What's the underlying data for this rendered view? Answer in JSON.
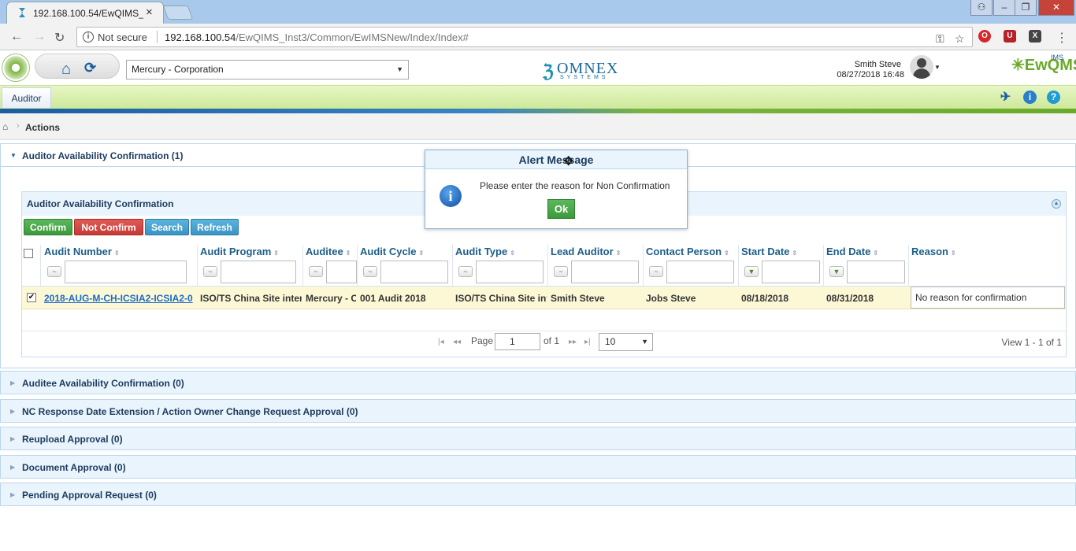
{
  "browser": {
    "tab_title": "192.168.100.54/EwQIMS_",
    "security_label": "Not secure",
    "url_host": "192.168.100.54",
    "url_path": "/EwQIMS_Inst3/Common/EwIMSNew/Index/Index#"
  },
  "header": {
    "org_select_value": "Mercury - Corporation",
    "omnex_name": "OMNEX",
    "omnex_sub": "SYSTEMS",
    "user_name": "Smith Steve",
    "user_datetime": "08/27/2018 16:48",
    "product_logo": "EwQMS",
    "product_logo_sup": "IMS"
  },
  "toolbar": {
    "role_tab": "Auditor"
  },
  "breadcrumb": {
    "label": "Actions"
  },
  "sections": [
    {
      "label": "Auditor Availability Confirmation (1)"
    },
    {
      "label": "Auditee Availability Confirmation (0)"
    },
    {
      "label": "NC Response Date Extension / Action Owner Change Request Approval (0)"
    },
    {
      "label": "Reupload Approval (0)"
    },
    {
      "label": "Document Approval (0)"
    },
    {
      "label": "Pending Approval Request (0)"
    }
  ],
  "grid": {
    "title": "Auditor Availability Confirmation",
    "buttons": {
      "confirm": "Confirm",
      "not_confirm": "Not Confirm",
      "search": "Search",
      "refresh": "Refresh"
    },
    "columns": [
      "Audit Number",
      "Audit Program",
      "Auditee",
      "Audit Cycle",
      "Audit Type",
      "Lead Auditor",
      "Contact Person",
      "Start Date",
      "End Date",
      "Reason"
    ],
    "rows": [
      {
        "audit_number": "2018-AUG-M-CH-ICSIA2-ICSIA2-0",
        "audit_program": "ISO/TS China Site inter",
        "auditee": "Mercury - Co",
        "audit_cycle": "001 Audit 2018",
        "audit_type": "ISO/TS China Site int",
        "lead_auditor": "Smith Steve",
        "contact_person": "Jobs Steve",
        "start_date": "08/18/2018",
        "end_date": "08/31/2018",
        "reason": "No reason for confirmation"
      }
    ],
    "pager": {
      "page_label": "Page",
      "page_value": "1",
      "of_label": "of 1",
      "page_size": "10",
      "view_text": "View 1 - 1 of 1"
    }
  },
  "modal": {
    "title": "Alert Message",
    "message": "Please enter the reason for Non Confirmation",
    "ok_label": "Ok"
  },
  "colors": {
    "accent_blue": "#1b5ea0",
    "accent_green": "#6aaa2a",
    "confirm_green": "#3c9a3c",
    "not_confirm_red": "#c73b36",
    "row_highlight": "#fcf8d6"
  }
}
